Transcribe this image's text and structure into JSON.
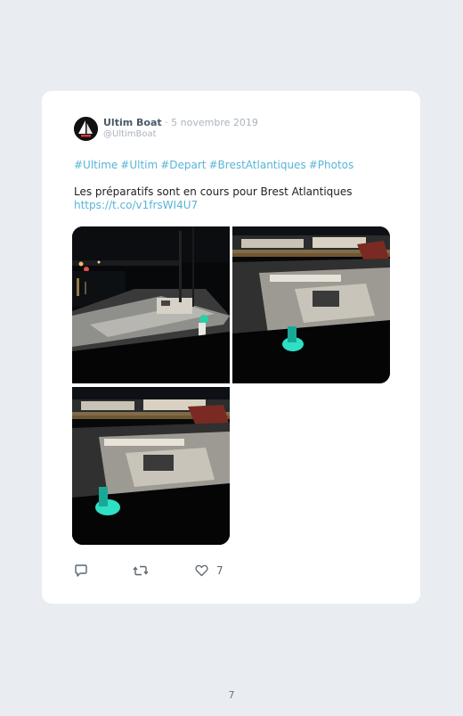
{
  "tweet": {
    "author_name": "Ultim Boat",
    "separator": "·",
    "date": "5 novembre 2019",
    "handle": "@UltimBoat",
    "hashtags": [
      "#Ultime",
      "#Ultim",
      "#Depart",
      "#BrestAtlantiques",
      "#Photos"
    ],
    "text": "Les préparatifs sont en cours pour Brest Atlantiques",
    "link": "https://t.co/v1frsWI4U7",
    "media": [
      {
        "icon": "night-harbor-photo"
      },
      {
        "icon": "boat-deck-night-photo"
      },
      {
        "icon": "boat-deck-night-photo"
      }
    ],
    "actions": {
      "reply_icon": "reply-icon",
      "retweet_icon": "retweet-icon",
      "like_icon": "heart-icon",
      "like_count": "7"
    }
  },
  "page": {
    "number": "7"
  },
  "colors": {
    "background": "#e9ecf0",
    "card": "#ffffff",
    "link": "#58b5d6",
    "muted": "#aab4bf",
    "author": "#4a5866"
  }
}
